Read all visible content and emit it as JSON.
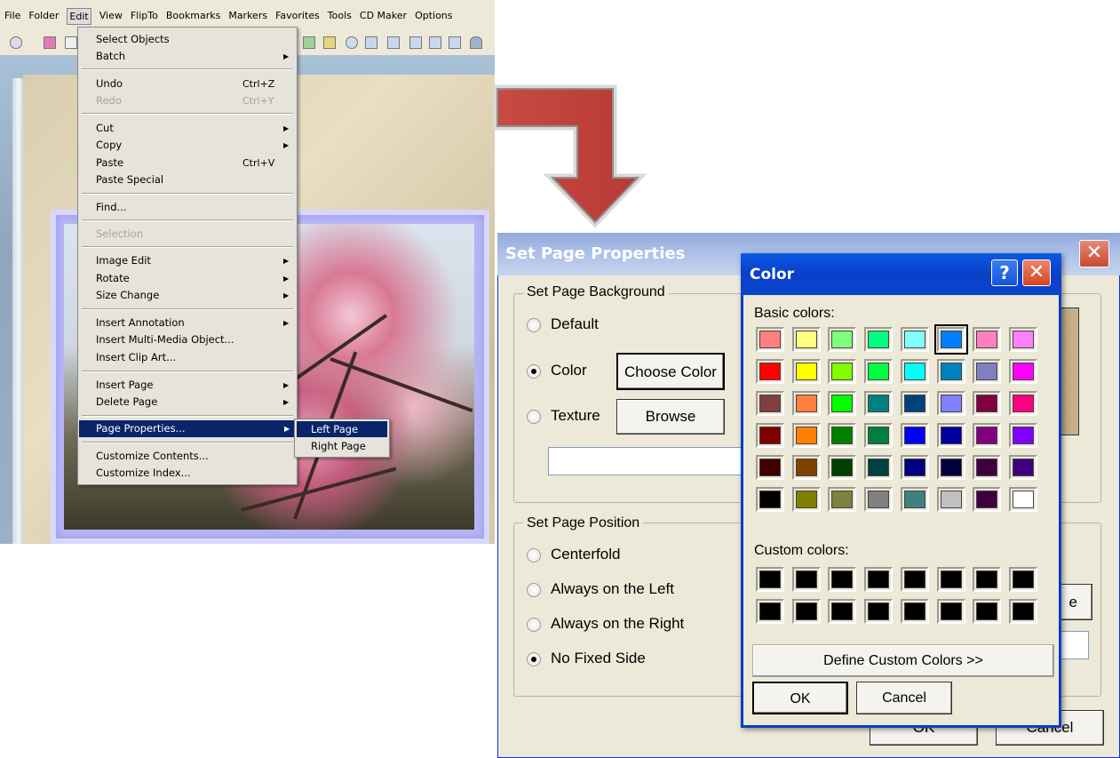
{
  "menubar": {
    "items": [
      "File",
      "Folder",
      "Edit",
      "View",
      "FlipTo",
      "Bookmarks",
      "Markers",
      "Favorites",
      "Tools",
      "CD Maker",
      "Options"
    ]
  },
  "edit_menu": {
    "select_objects": "Select Objects",
    "batch": "Batch",
    "undo": "Undo",
    "undo_shortcut": "Ctrl+Z",
    "redo": "Redo",
    "redo_shortcut": "Ctrl+Y",
    "cut": "Cut",
    "copy": "Copy",
    "paste": "Paste",
    "paste_shortcut": "Ctrl+V",
    "paste_special": "Paste Special",
    "find": "Find...",
    "selection": "Selection",
    "image_edit": "Image Edit",
    "rotate": "Rotate",
    "size_change": "Size Change",
    "insert_annotation": "Insert Annotation",
    "insert_multimedia": "Insert Multi-Media Object...",
    "insert_clip_art": "Insert Clip Art...",
    "insert_page": "Insert Page",
    "delete_page": "Delete Page",
    "page_properties": "Page Properties...",
    "customize_contents": "Customize Contents...",
    "customize_index": "Customize Index..."
  },
  "submenu": {
    "left_page": "Left Page",
    "right_page": "Right Page"
  },
  "set_page_properties": {
    "title": "Set Page Properties",
    "close_glyph": "✕",
    "background_group": "Set Page Background",
    "opt_default": "Default",
    "opt_color": "Color",
    "opt_texture": "Texture",
    "choose_color": "Choose Color",
    "browse": "Browse",
    "position_group": "Set Page Position",
    "opt_centerfold": "Centerfold",
    "opt_left": "Always on the Left",
    "opt_right": "Always on the Right",
    "opt_nofixed": "No Fixed Side",
    "partial_button": "e",
    "ok": "OK",
    "cancel": "Cancel"
  },
  "color_dialog": {
    "title": "Color",
    "help_glyph": "?",
    "close_glyph": "✕",
    "basic_colors_label": "Basic colors:",
    "custom_colors_label": "Custom colors:",
    "define_custom": "Define Custom Colors >>",
    "ok": "OK",
    "cancel": "Cancel",
    "basic_colors": [
      [
        "#ff8080",
        "#ffff80",
        "#80ff80",
        "#00ff80",
        "#80ffff",
        "#0080ff",
        "#ff80c0",
        "#ff80ff"
      ],
      [
        "#ff0000",
        "#ffff00",
        "#80ff00",
        "#00ff40",
        "#00ffff",
        "#0080c0",
        "#8080c0",
        "#ff00ff"
      ],
      [
        "#804040",
        "#ff8040",
        "#00ff00",
        "#008080",
        "#004080",
        "#8080ff",
        "#800040",
        "#ff0080"
      ],
      [
        "#800000",
        "#ff8000",
        "#008000",
        "#008040",
        "#0000ff",
        "#0000a0",
        "#800080",
        "#8000ff"
      ],
      [
        "#400000",
        "#804000",
        "#004000",
        "#004040",
        "#000080",
        "#000040",
        "#400040",
        "#400080"
      ],
      [
        "#000000",
        "#808000",
        "#808040",
        "#808080",
        "#408080",
        "#c0c0c0",
        "#400040",
        "#ffffff"
      ]
    ],
    "selected": "#0080ff",
    "custom_colors": [
      "#000000",
      "#000000",
      "#000000",
      "#000000",
      "#000000",
      "#000000",
      "#000000",
      "#000000",
      "#000000",
      "#000000",
      "#000000",
      "#000000",
      "#000000",
      "#000000",
      "#000000",
      "#000000"
    ]
  }
}
